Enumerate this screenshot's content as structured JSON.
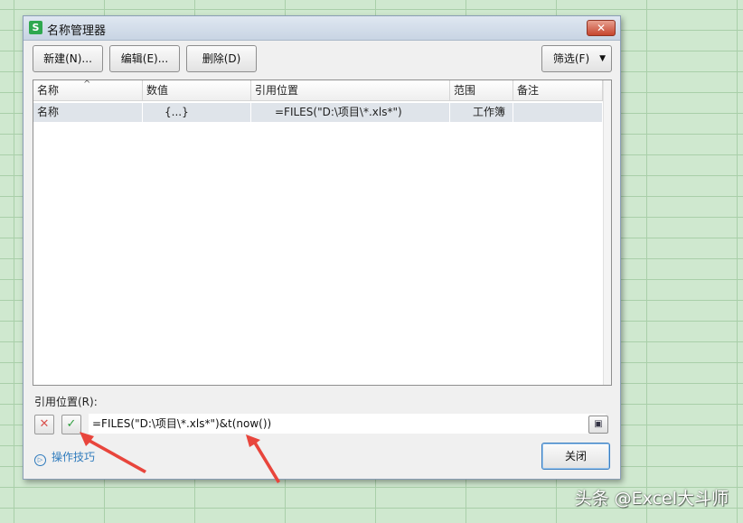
{
  "dialog": {
    "app_icon_glyph": "S",
    "title": "名称管理器",
    "close_glyph": "✕"
  },
  "toolbar": {
    "new_label": "新建(N)...",
    "edit_label": "编辑(E)...",
    "delete_label": "删除(D)",
    "filter_label": "筛选(F)",
    "filter_arrow": "▼"
  },
  "table": {
    "columns": [
      "名称",
      "数值",
      "引用位置",
      "范围",
      "备注"
    ],
    "rows": [
      {
        "name": "名称",
        "value": "{...}",
        "refers_to": "=FILES(\"D:\\项目\\*.xls*\")",
        "scope": "工作簿",
        "comment": ""
      }
    ]
  },
  "ref": {
    "label": "引用位置(R):",
    "value": "=FILES(\"D:\\项目\\*.xls*\")&t(now())",
    "cancel_glyph": "✕",
    "confirm_glyph": "✓"
  },
  "tips": {
    "label": "操作技巧",
    "icon_glyph": "▷"
  },
  "close_button": {
    "label": "关闭"
  },
  "watermark": "头条 @Excel大斗师",
  "colors": {
    "accent": "#2f7bbd",
    "arrow": "#e8453c",
    "cancel": "#d9534f",
    "confirm": "#2e9e3e"
  }
}
